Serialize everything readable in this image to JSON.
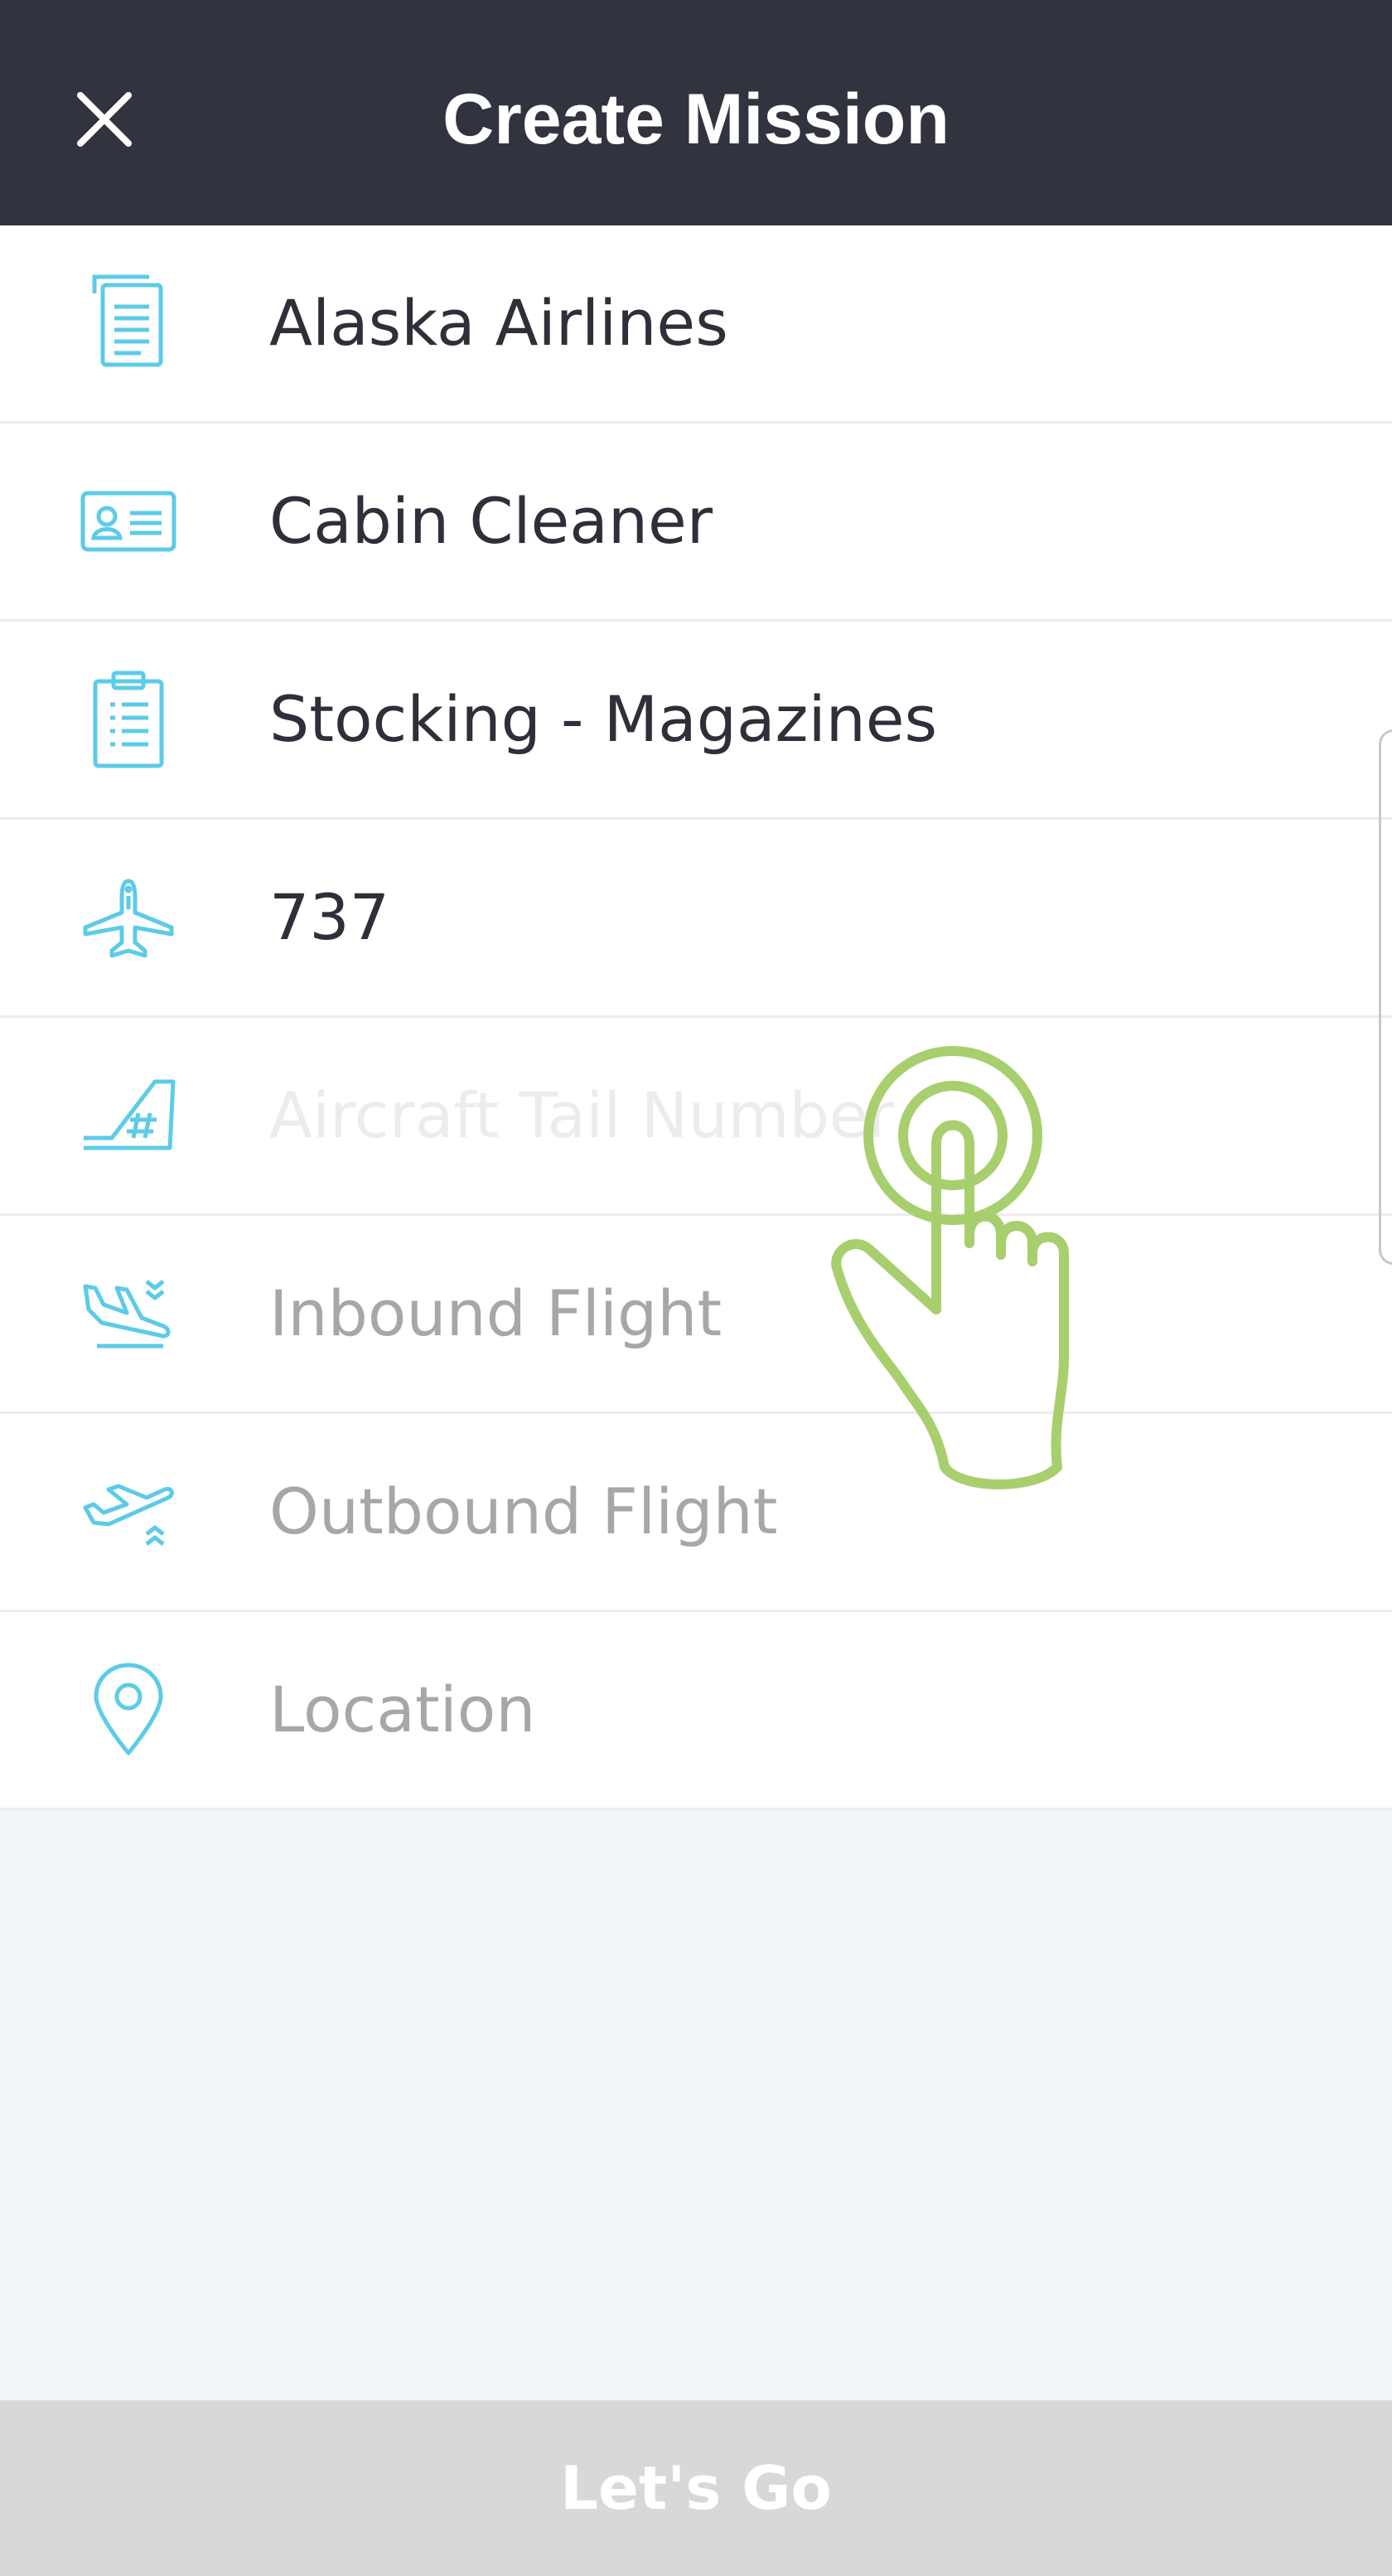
{
  "header": {
    "title": "Create Mission",
    "close_icon": "close-icon"
  },
  "fields": [
    {
      "icon": "document-icon",
      "value": "Alaska Airlines"
    },
    {
      "icon": "id-card-icon",
      "value": "Cabin Cleaner"
    },
    {
      "icon": "clipboard-icon",
      "value": "Stocking - Magazines"
    },
    {
      "icon": "plane-info-icon",
      "value": "737"
    },
    {
      "icon": "tail-number-icon",
      "placeholder": "Aircraft Tail Number"
    },
    {
      "icon": "plane-arrival-icon",
      "placeholder": "Inbound Flight"
    },
    {
      "icon": "plane-departure-icon",
      "placeholder": "Outbound Flight"
    },
    {
      "icon": "location-pin-icon",
      "placeholder": "Location"
    }
  ],
  "footer": {
    "button_label": "Let's Go"
  },
  "colors": {
    "header_bg": "#31333e",
    "icon_accent": "#5ccbe8",
    "hand_overlay": "#a8cf6e",
    "placeholder_text": "#a7a7a7",
    "button_bg": "#d8d8d8"
  }
}
